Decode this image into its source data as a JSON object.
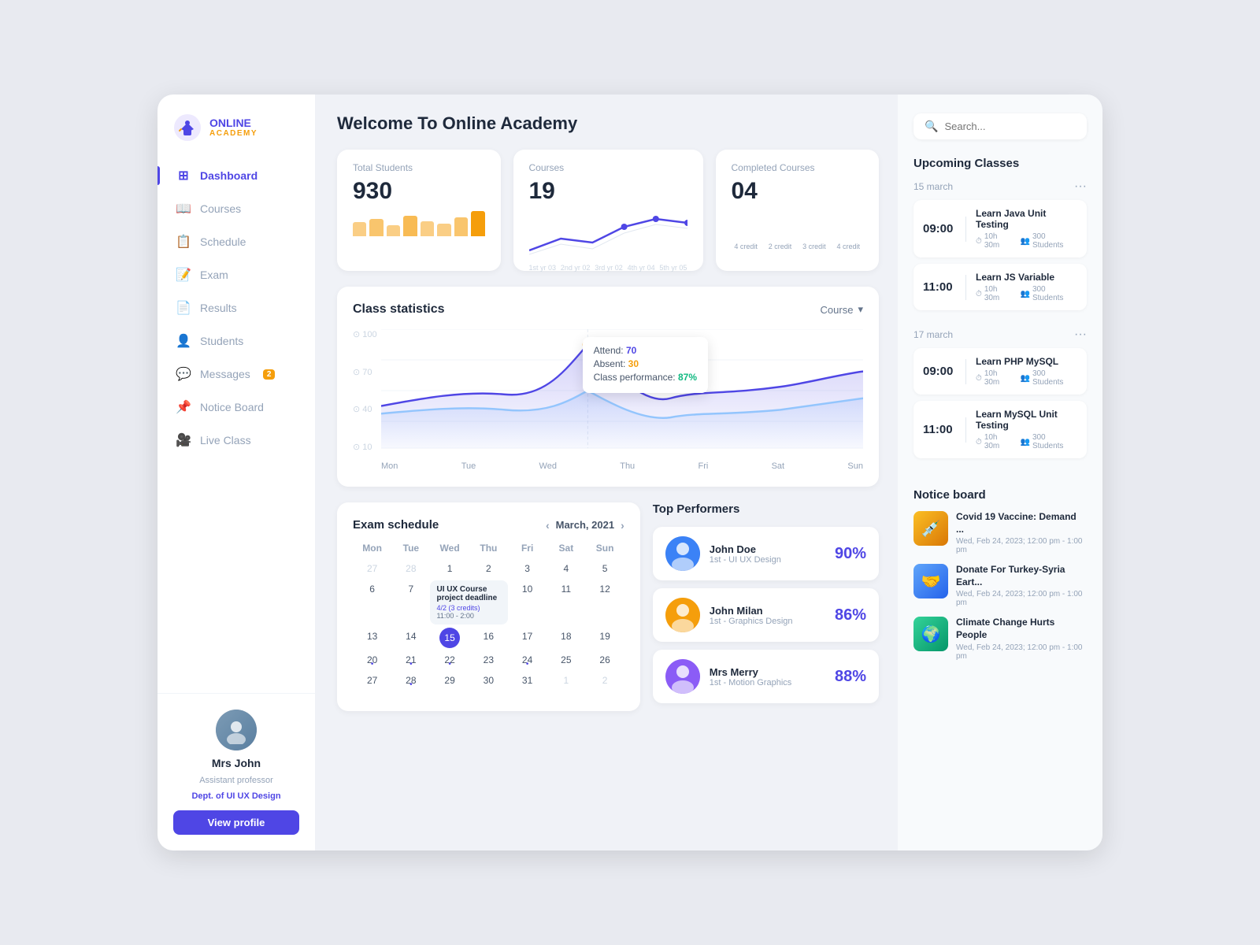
{
  "app": {
    "title": "Welcome To Online Academy",
    "logo_main": "ONLINE",
    "logo_sub": "ACADEMY"
  },
  "search": {
    "placeholder": "Search..."
  },
  "sidebar": {
    "items": [
      {
        "id": "dashboard",
        "label": "Dashboard",
        "icon": "⊞",
        "active": true
      },
      {
        "id": "courses",
        "label": "Courses",
        "icon": "📖",
        "active": false
      },
      {
        "id": "schedule",
        "label": "Schedule",
        "icon": "📋",
        "active": false
      },
      {
        "id": "exam",
        "label": "Exam",
        "icon": "📝",
        "active": false
      },
      {
        "id": "results",
        "label": "Results",
        "icon": "📄",
        "active": false
      },
      {
        "id": "students",
        "label": "Students",
        "icon": "👤",
        "active": false
      },
      {
        "id": "messages",
        "label": "Messages",
        "icon": "💬",
        "active": false,
        "badge": "2"
      },
      {
        "id": "noticeboard",
        "label": "Notice Board",
        "icon": "📌",
        "active": false
      },
      {
        "id": "liveclass",
        "label": "Live Class",
        "icon": "🎥",
        "active": false
      }
    ]
  },
  "profile": {
    "name": "Mrs John",
    "role": "Assistant professor",
    "dept_prefix": "Dept. of",
    "dept": "UI UX Design",
    "view_profile_label": "View profile"
  },
  "stats": {
    "total_students": {
      "label": "Total Students",
      "value": "930"
    },
    "courses": {
      "label": "Courses",
      "value": "19"
    },
    "completed": {
      "label": "Completed Courses",
      "value": "04"
    }
  },
  "class_statistics": {
    "title": "Class statistics",
    "course_label": "Course",
    "tooltip": {
      "attend_label": "Attend:",
      "attend_val": "70",
      "absent_label": "Absent:",
      "absent_val": "30",
      "perf_label": "Class performance:",
      "perf_val": "87%"
    },
    "y_labels": [
      "100",
      "70",
      "40",
      "10"
    ],
    "x_labels": [
      "Mon",
      "Tue",
      "Wed",
      "Thu",
      "Fri",
      "Sat",
      "Sun"
    ]
  },
  "exam_schedule": {
    "title": "Exam schedule",
    "month": "March, 2021",
    "day_headers": [
      "Mon",
      "Tue",
      "Wed",
      "Thu",
      "Fri",
      "Sat",
      "Sun"
    ],
    "event": {
      "title": "UI UX Course project deadline",
      "credits": "4/2 (3 credits)",
      "time": "11:00 - 2:00"
    }
  },
  "top_performers": {
    "title": "Top Performers",
    "performers": [
      {
        "name": "John Doe",
        "percent": "90%",
        "rank": "1st - UI UX Design"
      },
      {
        "name": "John Milan",
        "percent": "86%",
        "rank": "1st - Graphics Design"
      },
      {
        "name": "Mrs Merry",
        "percent": "88%",
        "rank": "1st - Motion Graphics"
      }
    ]
  },
  "upcoming_classes": {
    "title": "Upcoming Classes",
    "groups": [
      {
        "date": "15 march",
        "classes": [
          {
            "time": "09:00",
            "name": "Learn Java Unit Testing",
            "duration": "10h 30m",
            "students": "300 Students"
          },
          {
            "time": "11:00",
            "name": "Learn JS Variable",
            "duration": "10h 30m",
            "students": "300 Students"
          }
        ]
      },
      {
        "date": "17 march",
        "classes": [
          {
            "time": "09:00",
            "name": "Learn PHP MySQL",
            "duration": "10h 30m",
            "students": "300 Students"
          },
          {
            "time": "11:00",
            "name": "Learn MySQL Unit Testing",
            "duration": "10h 30m",
            "students": "300 Students"
          }
        ]
      }
    ]
  },
  "notice_board": {
    "title": "Notice board",
    "items": [
      {
        "title": "Covid 19 Vaccine: Demand ...",
        "date": "Wed, Feb 24, 2023; 12:00 pm - 1:00 pm"
      },
      {
        "title": "Donate For Turkey-Syria Eart...",
        "date": "Wed, Feb 24, 2023; 12:00 pm - 1:00 pm"
      },
      {
        "title": "Climate Change Hurts People",
        "date": "Wed, Feb 24, 2023; 12:00 pm - 1:00 pm"
      }
    ]
  },
  "colors": {
    "accent": "#4f46e5",
    "orange": "#f59e0b",
    "blue": "#3b82f6",
    "green": "#10b981",
    "light_bg": "#f8fafc"
  }
}
